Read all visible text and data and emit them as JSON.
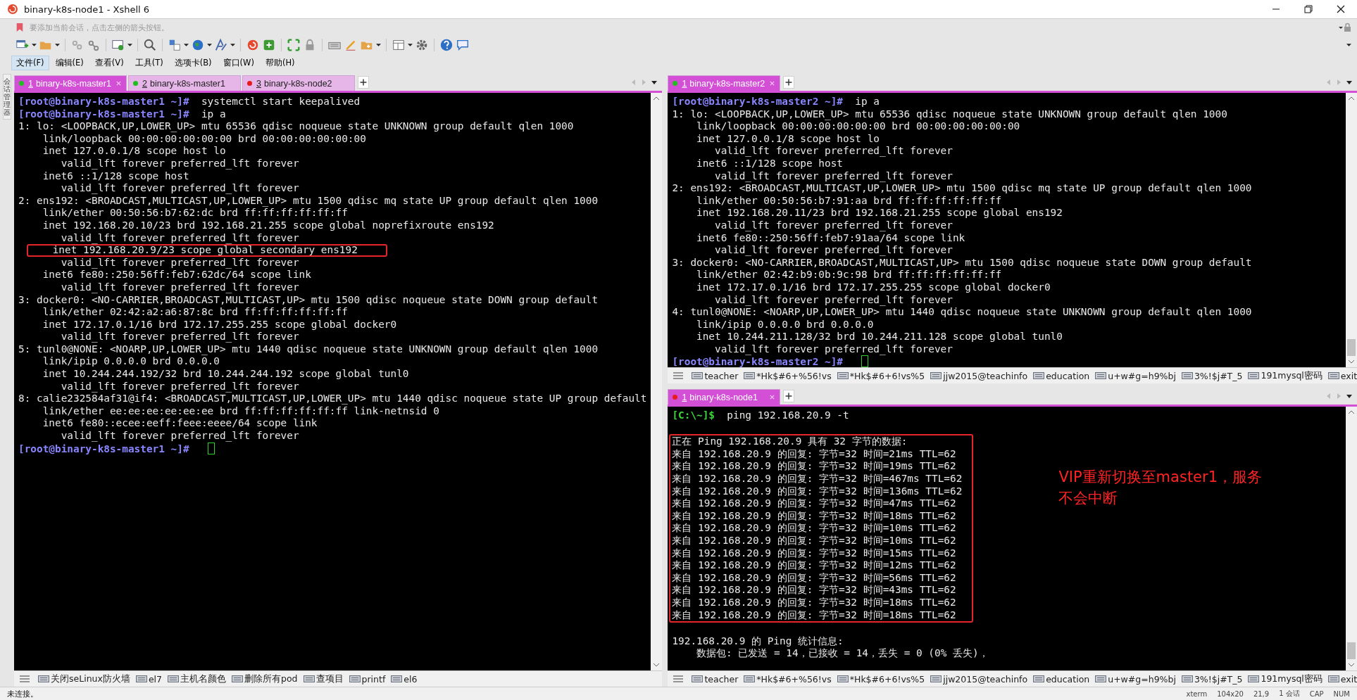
{
  "window": {
    "title": "binary-k8s-node1 - Xshell 6"
  },
  "address_bar": {
    "placeholder": "要添加当前会话，点击左侧的箭头按钮。"
  },
  "menu": [
    {
      "label": "文件(F)",
      "selected": true
    },
    {
      "label": "编辑(E)",
      "selected": false
    },
    {
      "label": "查看(V)",
      "selected": false
    },
    {
      "label": "工具(T)",
      "selected": false
    },
    {
      "label": "选项卡(B)",
      "selected": false
    },
    {
      "label": "窗口(W)",
      "selected": false
    },
    {
      "label": "帮助(H)",
      "selected": false
    }
  ],
  "side_panel": {
    "label": "会话管理器"
  },
  "left_pane": {
    "tabs": [
      {
        "number": "1",
        "label": "binary-k8s-master1",
        "color": "#1fbf1f",
        "selected": true
      },
      {
        "number": "2",
        "label": "binary-k8s-master1",
        "color": "#1fbf1f",
        "selected": false
      },
      {
        "number": "3",
        "label": "binary-k8s-node2",
        "color": "#e81b1b",
        "selected": false
      }
    ],
    "terminal": {
      "lines": [
        {
          "kind": "prompt",
          "prompt": "[root@binary-k8s-master1 ~]#",
          "command": "systemctl start keepalived"
        },
        {
          "kind": "prompt",
          "prompt": "[root@binary-k8s-master1 ~]#",
          "command": "ip a"
        },
        {
          "kind": "output",
          "text": "1: lo: <LOOPBACK,UP,LOWER_UP> mtu 65536 qdisc noqueue state UNKNOWN group default qlen 1000"
        },
        {
          "kind": "output",
          "text": "    link/loopback 00:00:00:00:00:00 brd 00:00:00:00:00:00"
        },
        {
          "kind": "output",
          "text": "    inet 127.0.0.1/8 scope host lo"
        },
        {
          "kind": "output",
          "text": "       valid_lft forever preferred_lft forever"
        },
        {
          "kind": "output",
          "text": "    inet6 ::1/128 scope host"
        },
        {
          "kind": "output",
          "text": "       valid_lft forever preferred_lft forever"
        },
        {
          "kind": "output",
          "text": "2: ens192: <BROADCAST,MULTICAST,UP,LOWER_UP> mtu 1500 qdisc mq state UP group default qlen 1000"
        },
        {
          "kind": "output",
          "text": "    link/ether 00:50:56:b7:62:dc brd ff:ff:ff:ff:ff:ff"
        },
        {
          "kind": "output",
          "text": "    inet 192.168.20.10/23 brd 192.168.21.255 scope global noprefixroute ens192"
        },
        {
          "kind": "output",
          "text": "       valid_lft forever preferred_lft forever"
        },
        {
          "kind": "output",
          "text": "    inet 192.168.20.9/23 scope global secondary ens192",
          "highlighted": true
        },
        {
          "kind": "output",
          "text": "       valid_lft forever preferred_lft forever"
        },
        {
          "kind": "output",
          "text": "    inet6 fe80::250:56ff:feb7:62dc/64 scope link"
        },
        {
          "kind": "output",
          "text": "       valid_lft forever preferred_lft forever"
        },
        {
          "kind": "output",
          "text": "3: docker0: <NO-CARRIER,BROADCAST,MULTICAST,UP> mtu 1500 qdisc noqueue state DOWN group default"
        },
        {
          "kind": "output",
          "text": "    link/ether 02:42:a2:a6:87:8c brd ff:ff:ff:ff:ff:ff"
        },
        {
          "kind": "output",
          "text": "    inet 172.17.0.1/16 brd 172.17.255.255 scope global docker0"
        },
        {
          "kind": "output",
          "text": "       valid_lft forever preferred_lft forever"
        },
        {
          "kind": "output",
          "text": "5: tunl0@NONE: <NOARP,UP,LOWER_UP> mtu 1440 qdisc noqueue state UNKNOWN group default qlen 1000"
        },
        {
          "kind": "output",
          "text": "    link/ipip 0.0.0.0 brd 0.0.0.0"
        },
        {
          "kind": "output",
          "text": "    inet 10.244.244.192/32 brd 10.244.244.192 scope global tunl0"
        },
        {
          "kind": "output",
          "text": "       valid_lft forever preferred_lft forever"
        },
        {
          "kind": "output",
          "text": "8: calie232584af31@if4: <BROADCAST,MULTICAST,UP,LOWER_UP> mtu 1440 qdisc noqueue state UP group default"
        },
        {
          "kind": "output",
          "text": "    link/ether ee:ee:ee:ee:ee:ee brd ff:ff:ff:ff:ff:ff link-netnsid 0"
        },
        {
          "kind": "output",
          "text": "    inet6 fe80::ecee:eeff:feee:eeee/64 scope link"
        },
        {
          "kind": "output",
          "text": "       valid_lft forever preferred_lft forever"
        },
        {
          "kind": "prompt",
          "prompt": "[root@binary-k8s-master1 ~]#",
          "cursor": true
        }
      ]
    },
    "quick_commands": [
      "关闭seLinux防火墙",
      "el7",
      "主机名颜色",
      "删除所有pod",
      "查项目",
      "printf",
      "el6"
    ]
  },
  "right_top_pane": {
    "tabs": [
      {
        "number": "1",
        "label": "binary-k8s-master2",
        "color": "#1fbf1f",
        "selected": true
      }
    ],
    "terminal": {
      "lines": [
        {
          "kind": "prompt",
          "prompt": "[root@binary-k8s-master2 ~]#",
          "command": "ip a"
        },
        {
          "kind": "output",
          "text": "1: lo: <LOOPBACK,UP,LOWER_UP> mtu 65536 qdisc noqueue state UNKNOWN group default qlen 1000"
        },
        {
          "kind": "output",
          "text": "    link/loopback 00:00:00:00:00:00 brd 00:00:00:00:00:00"
        },
        {
          "kind": "output",
          "text": "    inet 127.0.0.1/8 scope host lo"
        },
        {
          "kind": "output",
          "text": "       valid_lft forever preferred_lft forever"
        },
        {
          "kind": "output",
          "text": "    inet6 ::1/128 scope host"
        },
        {
          "kind": "output",
          "text": "       valid_lft forever preferred_lft forever"
        },
        {
          "kind": "output",
          "text": "2: ens192: <BROADCAST,MULTICAST,UP,LOWER_UP> mtu 1500 qdisc mq state UP group default qlen 1000"
        },
        {
          "kind": "output",
          "text": "    link/ether 00:50:56:b7:91:aa brd ff:ff:ff:ff:ff:ff"
        },
        {
          "kind": "output",
          "text": "    inet 192.168.20.11/23 brd 192.168.21.255 scope global ens192"
        },
        {
          "kind": "output",
          "text": "       valid_lft forever preferred_lft forever"
        },
        {
          "kind": "output",
          "text": "    inet6 fe80::250:56ff:feb7:91aa/64 scope link"
        },
        {
          "kind": "output",
          "text": "       valid_lft forever preferred_lft forever"
        },
        {
          "kind": "output",
          "text": "3: docker0: <NO-CARRIER,BROADCAST,MULTICAST,UP> mtu 1500 qdisc noqueue state DOWN group default"
        },
        {
          "kind": "output",
          "text": "    link/ether 02:42:b9:0b:9c:98 brd ff:ff:ff:ff:ff:ff"
        },
        {
          "kind": "output",
          "text": "    inet 172.17.0.1/16 brd 172.17.255.255 scope global docker0"
        },
        {
          "kind": "output",
          "text": "       valid_lft forever preferred_lft forever"
        },
        {
          "kind": "output",
          "text": "4: tunl0@NONE: <NOARP,UP,LOWER_UP> mtu 1440 qdisc noqueue state UNKNOWN group default qlen 1000"
        },
        {
          "kind": "output",
          "text": "    link/ipip 0.0.0.0 brd 0.0.0.0"
        },
        {
          "kind": "output",
          "text": "    inet 10.244.211.128/32 brd 10.244.211.128 scope global tunl0"
        },
        {
          "kind": "output",
          "text": "       valid_lft forever preferred_lft forever"
        },
        {
          "kind": "prompt",
          "prompt": "[root@binary-k8s-master2 ~]#",
          "cursor": true
        }
      ]
    },
    "quick_commands": [
      "teacher",
      "*Hk$#6+%56!vs",
      "*Hk$#6+6!vs%5",
      "jjw2015@teachinfo",
      "education",
      "u+w#g=h9%bj",
      "3%!$j#T_5",
      "191mysql密码",
      "exit"
    ]
  },
  "right_bottom_pane": {
    "tabs": [
      {
        "number": "1",
        "label": "binary-k8s-node1",
        "color": "#e81b1b",
        "selected": true
      }
    ],
    "terminal": {
      "lines": [
        {
          "kind": "windows_prompt",
          "prompt": "[C:\\~]$",
          "command": "ping 192.168.20.9 -t"
        },
        {
          "kind": "blank"
        }
      ],
      "boxed_lines": [
        "正在 Ping 192.168.20.9 具有 32 字节的数据:",
        "来自 192.168.20.9 的回复: 字节=32 时间=21ms TTL=62",
        "来自 192.168.20.9 的回复: 字节=32 时间=19ms TTL=62",
        "来自 192.168.20.9 的回复: 字节=32 时间=467ms TTL=62",
        "来自 192.168.20.9 的回复: 字节=32 时间=136ms TTL=62",
        "来自 192.168.20.9 的回复: 字节=32 时间=47ms TTL=62",
        "来自 192.168.20.9 的回复: 字节=32 时间=18ms TTL=62",
        "来自 192.168.20.9 的回复: 字节=32 时间=10ms TTL=62",
        "来自 192.168.20.9 的回复: 字节=32 时间=10ms TTL=62",
        "来自 192.168.20.9 的回复: 字节=32 时间=15ms TTL=62",
        "来自 192.168.20.9 的回复: 字节=32 时间=12ms TTL=62",
        "来自 192.168.20.9 的回复: 字节=32 时间=56ms TTL=62",
        "来自 192.168.20.9 的回复: 字节=32 时间=43ms TTL=62",
        "来自 192.168.20.9 的回复: 字节=32 时间=18ms TTL=62",
        "来自 192.168.20.9 的回复: 字节=32 时间=18ms TTL=62"
      ],
      "lines_after": [
        {
          "kind": "blank"
        },
        {
          "kind": "output",
          "text": "192.168.20.9 的 Ping 统计信息:"
        },
        {
          "kind": "output",
          "text": "    数据包: 已发送 = 14，已接收 = 14，丢失 = 0 (0% 丢失)，"
        }
      ],
      "annotation": "VIP重新切换至master1，服务不会中断"
    },
    "quick_commands": [
      "teacher",
      "*Hk$#6+%56!vs",
      "*Hk$#6+6!vs%5",
      "jjw2015@teachinfo",
      "education",
      "u+w#g=h9%bj",
      "3%!$j#T_5",
      "191mysql密码",
      "exit"
    ]
  },
  "status_bar": {
    "message": "未连接。",
    "items": [
      "xterm",
      "104x20",
      "21,9",
      "1 会话",
      "CAP",
      "NUM"
    ]
  }
}
